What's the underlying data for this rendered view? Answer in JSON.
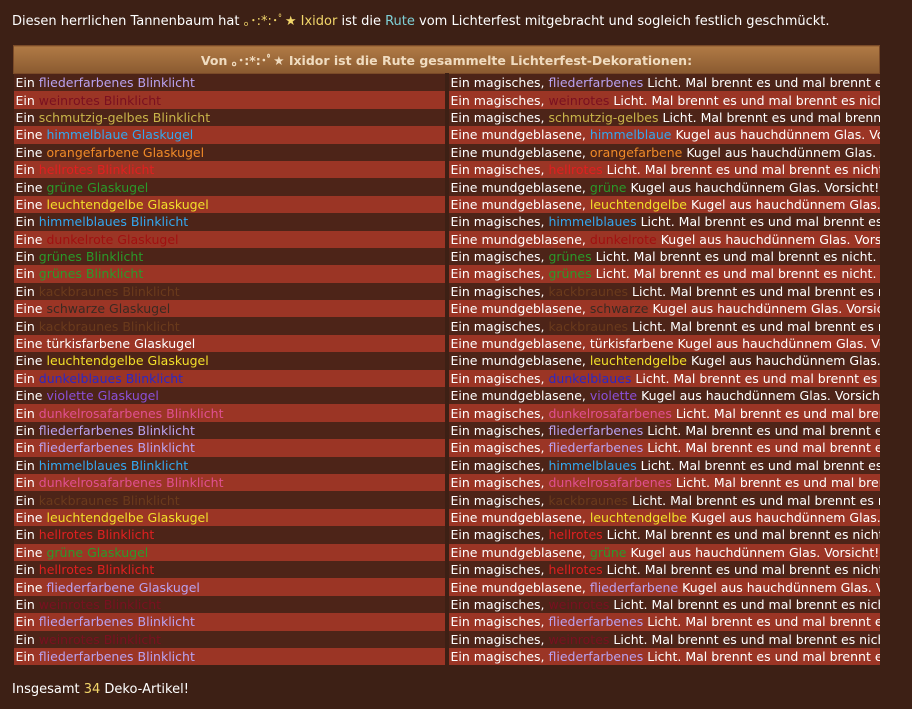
{
  "intro": {
    "text_before": "Diesen herrlichen Tannenbaum hat ",
    "user": "｡･:*:･ﾟ★ Ixidor",
    "text_middle": " ist die ",
    "rute": "Rute",
    "text_after": " vom Lichterfest mitgebracht und sogleich festlich geschmückt."
  },
  "table": {
    "header": "Von ｡･:*:･ﾟ★ Ixidor ist die Rute gesammelte Lichterfest-Dekorationen:",
    "rows": [
      {
        "art": "Ein",
        "adj": "fliederfarbenes",
        "noun": "Blinklicht",
        "pre": "Ein magisches,",
        "dadj": "fliederfarbenes",
        "post": "Licht. Mal brennt es und mal brennt es nicht.",
        "color": "#b9a2f0"
      },
      {
        "art": "Ein",
        "adj": "weinrotes",
        "noun": "Blinklicht",
        "pre": "Ein magisches,",
        "dadj": "weinrotes",
        "post": "Licht. Mal brennt es und mal brennt es nicht.",
        "color": "#7a1020"
      },
      {
        "art": "Ein",
        "adj": "schmutzig-gelbes",
        "noun": "Blinklicht",
        "pre": "Ein magisches,",
        "dadj": "schmutzig-gelbes",
        "post": "Licht. Mal brennt es und mal brennt es nicht.",
        "color": "#c9b54a"
      },
      {
        "art": "Eine",
        "adj": "himmelblaue",
        "noun": "Glaskugel",
        "pre": "Eine mundgeblasene,",
        "dadj": "himmelblaue",
        "post": "Kugel aus hauchdünnem Glas. Vorsicht! Leicht zerbrechlich!",
        "color": "#33a8f0"
      },
      {
        "art": "Eine",
        "adj": "orangefarbene",
        "noun": "Glaskugel",
        "pre": "Eine mundgeblasene,",
        "dadj": "orangefarbene",
        "post": "Kugel aus hauchdünnem Glas. Vorsicht! Leicht zerbrechlich!",
        "color": "#f08a28"
      },
      {
        "art": "Ein",
        "adj": "hellrotes",
        "noun": "Blinklicht",
        "pre": "Ein magisches,",
        "dadj": "hellrotes",
        "post": "Licht. Mal brennt es und mal brennt es nicht.",
        "color": "#e02020"
      },
      {
        "art": "Eine",
        "adj": "grüne",
        "noun": "Glaskugel",
        "pre": "Eine mundgeblasene,",
        "dadj": "grüne",
        "post": "Kugel aus hauchdünnem Glas. Vorsicht! Leicht zerbrechlich!",
        "color": "#2a9a2a"
      },
      {
        "art": "Eine",
        "adj": "leuchtendgelbe",
        "noun": "Glaskugel",
        "pre": "Eine mundgeblasene,",
        "dadj": "leuchtendgelbe",
        "post": "Kugel aus hauchdünnem Glas. Vorsicht! Leicht zerbrechlich!",
        "color": "#f2e02a"
      },
      {
        "art": "Ein",
        "adj": "himmelblaues",
        "noun": "Blinklicht",
        "pre": "Ein magisches,",
        "dadj": "himmelblaues",
        "post": "Licht. Mal brennt es und mal brennt es nicht.",
        "color": "#33a8f0"
      },
      {
        "art": "Eine",
        "adj": "dunkelrote",
        "noun": "Glaskugel",
        "pre": "Eine mundgeblasene,",
        "dadj": "dunkelrote",
        "post": "Kugel aus hauchdünnem Glas. Vorsicht! Leicht zerbrechlich!",
        "color": "#a01010"
      },
      {
        "art": "Ein",
        "adj": "grünes",
        "noun": "Blinklicht",
        "pre": "Ein magisches,",
        "dadj": "grünes",
        "post": "Licht. Mal brennt es und mal brennt es nicht.",
        "color": "#2a9a2a"
      },
      {
        "art": "Ein",
        "adj": "grünes",
        "noun": "Blinklicht",
        "pre": "Ein magisches,",
        "dadj": "grünes",
        "post": "Licht. Mal brennt es und mal brennt es nicht.",
        "color": "#2a9a2a"
      },
      {
        "art": "Ein",
        "adj": "kackbraunes",
        "noun": "Blinklicht",
        "pre": "Ein magisches,",
        "dadj": "kackbraunes",
        "post": "Licht. Mal brennt es und mal brennt es nicht.",
        "color": "#6a3a1c"
      },
      {
        "art": "Eine",
        "adj": "schwarze",
        "noun": "Glaskugel",
        "pre": "Eine mundgeblasene,",
        "dadj": "schwarze",
        "post": "Kugel aus hauchdünnem Glas. Vorsicht! Leicht zerbrechlich!",
        "color": "#3a2a22"
      },
      {
        "art": "Ein",
        "adj": "kackbraunes",
        "noun": "Blinklicht",
        "pre": "Ein magisches,",
        "dadj": "kackbraunes",
        "post": "Licht. Mal brennt es und mal brennt es nicht.",
        "color": "#6a3a1c"
      },
      {
        "art": "Eine",
        "adj": "türkisfarbene",
        "noun": "Glaskugel",
        "pre": "Eine mundgeblasene,",
        "dadj": "türkisfarbene",
        "post": "Kugel aus hauchdünnem Glas. Vorsicht! Leicht zerbrechlich!",
        "color": "#ffffff"
      },
      {
        "art": "Eine",
        "adj": "leuchtendgelbe",
        "noun": "Glaskugel",
        "pre": "Eine mundgeblasene,",
        "dadj": "leuchtendgelbe",
        "post": "Kugel aus hauchdünnem Glas. Vorsicht! Leicht zerbrechlich!",
        "color": "#f2e02a"
      },
      {
        "art": "Ein",
        "adj": "dunkelblaues",
        "noun": "Blinklicht",
        "pre": "Ein magisches,",
        "dadj": "dunkelblaues",
        "post": "Licht. Mal brennt es und mal brennt es nicht.",
        "color": "#2a28c8"
      },
      {
        "art": "Eine",
        "adj": "violette",
        "noun": "Glaskugel",
        "pre": "Eine mundgeblasene,",
        "dadj": "violette",
        "post": "Kugel aus hauchdünnem Glas. Vorsicht! Leicht zerbrechlich!",
        "color": "#8a50d8"
      },
      {
        "art": "Ein",
        "adj": "dunkelrosafarbenes",
        "noun": "Blinklicht",
        "pre": "Ein magisches,",
        "dadj": "dunkelrosafarbenes",
        "post": "Licht. Mal brennt es und mal brennt es nicht.",
        "color": "#e05090"
      },
      {
        "art": "Ein",
        "adj": "fliederfarbenes",
        "noun": "Blinklicht",
        "pre": "Ein magisches,",
        "dadj": "fliederfarbenes",
        "post": "Licht. Mal brennt es und mal brennt es nicht.",
        "color": "#b9a2f0"
      },
      {
        "art": "Ein",
        "adj": "fliederfarbenes",
        "noun": "Blinklicht",
        "pre": "Ein magisches,",
        "dadj": "fliederfarbenes",
        "post": "Licht. Mal brennt es und mal brennt es nicht.",
        "color": "#b9a2f0"
      },
      {
        "art": "Ein",
        "adj": "himmelblaues",
        "noun": "Blinklicht",
        "pre": "Ein magisches,",
        "dadj": "himmelblaues",
        "post": "Licht. Mal brennt es und mal brennt es nicht.",
        "color": "#33a8f0"
      },
      {
        "art": "Ein",
        "adj": "dunkelrosafarbenes",
        "noun": "Blinklicht",
        "pre": "Ein magisches,",
        "dadj": "dunkelrosafarbenes",
        "post": "Licht. Mal brennt es und mal brennt es nicht.",
        "color": "#e05090"
      },
      {
        "art": "Ein",
        "adj": "kackbraunes",
        "noun": "Blinklicht",
        "pre": "Ein magisches,",
        "dadj": "kackbraunes",
        "post": "Licht. Mal brennt es und mal brennt es nicht.",
        "color": "#6a3a1c"
      },
      {
        "art": "Eine",
        "adj": "leuchtendgelbe",
        "noun": "Glaskugel",
        "pre": "Eine mundgeblasene,",
        "dadj": "leuchtendgelbe",
        "post": "Kugel aus hauchdünnem Glas. Vorsicht! Leicht zerbrechlich!",
        "color": "#f2e02a"
      },
      {
        "art": "Ein",
        "adj": "hellrotes",
        "noun": "Blinklicht",
        "pre": "Ein magisches,",
        "dadj": "hellrotes",
        "post": "Licht. Mal brennt es und mal brennt es nicht.",
        "color": "#e02020"
      },
      {
        "art": "Eine",
        "adj": "grüne",
        "noun": "Glaskugel",
        "pre": "Eine mundgeblasene,",
        "dadj": "grüne",
        "post": "Kugel aus hauchdünnem Glas. Vorsicht! Leicht zerbrechlich!",
        "color": "#2a9a2a"
      },
      {
        "art": "Ein",
        "adj": "hellrotes",
        "noun": "Blinklicht",
        "pre": "Ein magisches,",
        "dadj": "hellrotes",
        "post": "Licht. Mal brennt es und mal brennt es nicht.",
        "color": "#e02020"
      },
      {
        "art": "Eine",
        "adj": "fliederfarbene",
        "noun": "Glaskugel",
        "pre": "Eine mundgeblasene,",
        "dadj": "fliederfarbene",
        "post": "Kugel aus hauchdünnem Glas. Vorsicht! Leicht zerbrechlich!",
        "color": "#b9a2f0"
      },
      {
        "art": "Ein",
        "adj": "weinrotes",
        "noun": "Blinklicht",
        "pre": "Ein magisches,",
        "dadj": "weinrotes",
        "post": "Licht. Mal brennt es und mal brennt es nicht.",
        "color": "#7a1020"
      },
      {
        "art": "Ein",
        "adj": "fliederfarbenes",
        "noun": "Blinklicht",
        "pre": "Ein magisches,",
        "dadj": "fliederfarbenes",
        "post": "Licht. Mal brennt es und mal brennt es nicht.",
        "color": "#b9a2f0"
      },
      {
        "art": "Ein",
        "adj": "weinrotes",
        "noun": "Blinklicht",
        "pre": "Ein magisches,",
        "dadj": "weinrotes",
        "post": "Licht. Mal brennt es und mal brennt es nicht.",
        "color": "#7a1020"
      },
      {
        "art": "Ein",
        "adj": "fliederfarbenes",
        "noun": "Blinklicht",
        "pre": "Ein magisches,",
        "dadj": "fliederfarbenes",
        "post": "Licht. Mal brennt es und mal brennt es nicht.",
        "color": "#b9a2f0"
      }
    ]
  },
  "summary": {
    "before": "Insgesamt ",
    "count": "34",
    "after": " Deko-Artikel!"
  }
}
